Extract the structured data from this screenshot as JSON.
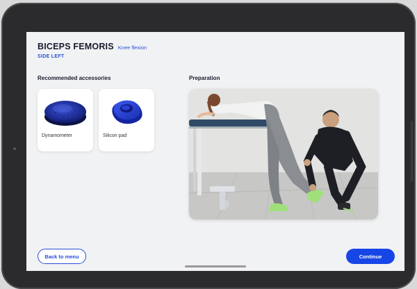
{
  "header": {
    "muscle": "BICEPS FEMORIS",
    "movement": "Knee flexion",
    "side": "SIDE LEFT"
  },
  "accessories": {
    "title": "Recommended accessories",
    "items": [
      {
        "label": "Dynamometer",
        "icon": "dynamometer-icon"
      },
      {
        "label": "Silicon pad",
        "icon": "silicon-pad-icon"
      }
    ]
  },
  "preparation": {
    "title": "Preparation"
  },
  "actions": {
    "back_label": "Back to menu",
    "continue_label": "Continue"
  },
  "colors": {
    "accent": "#1646e6",
    "text_dark": "#1a1a2e",
    "accessory_blue": "#2233a8"
  }
}
